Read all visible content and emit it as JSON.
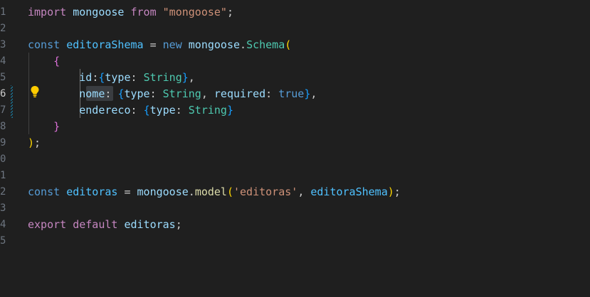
{
  "editor": {
    "line_numbers": [
      "1",
      "2",
      "3",
      "4",
      "5",
      "6",
      "7",
      "8",
      "9",
      "0",
      "1",
      "2",
      "3",
      "4",
      "5"
    ],
    "active_line_number": "6",
    "lines": [
      [
        {
          "t": "import",
          "c": "kw"
        },
        {
          "t": " ",
          "c": "pn"
        },
        {
          "t": "mongoose",
          "c": "var"
        },
        {
          "t": " ",
          "c": "pn"
        },
        {
          "t": "from",
          "c": "kw"
        },
        {
          "t": " ",
          "c": "pn"
        },
        {
          "t": "\"mongoose\"",
          "c": "str"
        },
        {
          "t": ";",
          "c": "pn"
        }
      ],
      [],
      [
        {
          "t": "const",
          "c": "kw2"
        },
        {
          "t": " ",
          "c": "pn"
        },
        {
          "t": "editoraShema",
          "c": "const"
        },
        {
          "t": " = ",
          "c": "pn"
        },
        {
          "t": "new",
          "c": "kw2"
        },
        {
          "t": " ",
          "c": "pn"
        },
        {
          "t": "mongoose",
          "c": "var"
        },
        {
          "t": ".",
          "c": "pn"
        },
        {
          "t": "Schema",
          "c": "cls"
        },
        {
          "t": "(",
          "c": "b1"
        }
      ],
      [
        {
          "t": "    ",
          "c": "pn"
        },
        {
          "t": "{",
          "c": "b2"
        }
      ],
      [
        {
          "t": "        ",
          "c": "pn"
        },
        {
          "t": "id",
          "c": "var"
        },
        {
          "t": ":",
          "c": "pn"
        },
        {
          "t": "{",
          "c": "b3"
        },
        {
          "t": "type",
          "c": "var"
        },
        {
          "t": ": ",
          "c": "pn"
        },
        {
          "t": "String",
          "c": "cls"
        },
        {
          "t": "}",
          "c": "b3"
        },
        {
          "t": ",",
          "c": "pn"
        }
      ],
      [
        {
          "t": "        ",
          "c": "pn"
        },
        {
          "t": "nome",
          "c": "var"
        },
        {
          "t": ": ",
          "c": "pn"
        },
        {
          "t": "{",
          "c": "b3"
        },
        {
          "t": "type",
          "c": "var"
        },
        {
          "t": ": ",
          "c": "pn"
        },
        {
          "t": "String",
          "c": "cls"
        },
        {
          "t": ", ",
          "c": "pn"
        },
        {
          "t": "required",
          "c": "var"
        },
        {
          "t": ": ",
          "c": "pn"
        },
        {
          "t": "true",
          "c": "kw2"
        },
        {
          "t": "}",
          "c": "b3"
        },
        {
          "t": ",",
          "c": "pn"
        }
      ],
      [
        {
          "t": "        ",
          "c": "pn"
        },
        {
          "t": "endereco",
          "c": "var"
        },
        {
          "t": ": ",
          "c": "pn"
        },
        {
          "t": "{",
          "c": "b3"
        },
        {
          "t": "type",
          "c": "var"
        },
        {
          "t": ": ",
          "c": "pn"
        },
        {
          "t": "String",
          "c": "cls"
        },
        {
          "t": "}",
          "c": "b3"
        }
      ],
      [
        {
          "t": "    ",
          "c": "pn"
        },
        {
          "t": "}",
          "c": "b2"
        }
      ],
      [
        {
          "t": ")",
          "c": "b1"
        },
        {
          "t": ";",
          "c": "pn"
        }
      ],
      [],
      [],
      [
        {
          "t": "const",
          "c": "kw2"
        },
        {
          "t": " ",
          "c": "pn"
        },
        {
          "t": "editoras",
          "c": "const"
        },
        {
          "t": " = ",
          "c": "pn"
        },
        {
          "t": "mongoose",
          "c": "var"
        },
        {
          "t": ".",
          "c": "pn"
        },
        {
          "t": "model",
          "c": "fn"
        },
        {
          "t": "(",
          "c": "b1"
        },
        {
          "t": "'editoras'",
          "c": "str"
        },
        {
          "t": ", ",
          "c": "pn"
        },
        {
          "t": "editoraShema",
          "c": "const"
        },
        {
          "t": ")",
          "c": "b1"
        },
        {
          "t": ";",
          "c": "pn"
        }
      ],
      [],
      [
        {
          "t": "export",
          "c": "kw"
        },
        {
          "t": " ",
          "c": "pn"
        },
        {
          "t": "default",
          "c": "kw"
        },
        {
          "t": " ",
          "c": "pn"
        },
        {
          "t": "editoras",
          "c": "var"
        },
        {
          "t": ";",
          "c": "pn"
        }
      ],
      []
    ],
    "lightbulb_icon": "lightbulb-icon",
    "colors": {
      "background": "#1f1f1f",
      "keyword_purple": "#c586c0",
      "keyword_blue": "#569cd6",
      "variable": "#9cdcfe",
      "constant": "#4fc1ff",
      "function": "#dcdcaa",
      "class": "#4ec9b0",
      "string": "#ce9178",
      "bracket_gold": "#ffd700",
      "bracket_orchid": "#da70d6",
      "bracket_blue": "#179fff",
      "lightbulb": "#ffcc00"
    }
  }
}
